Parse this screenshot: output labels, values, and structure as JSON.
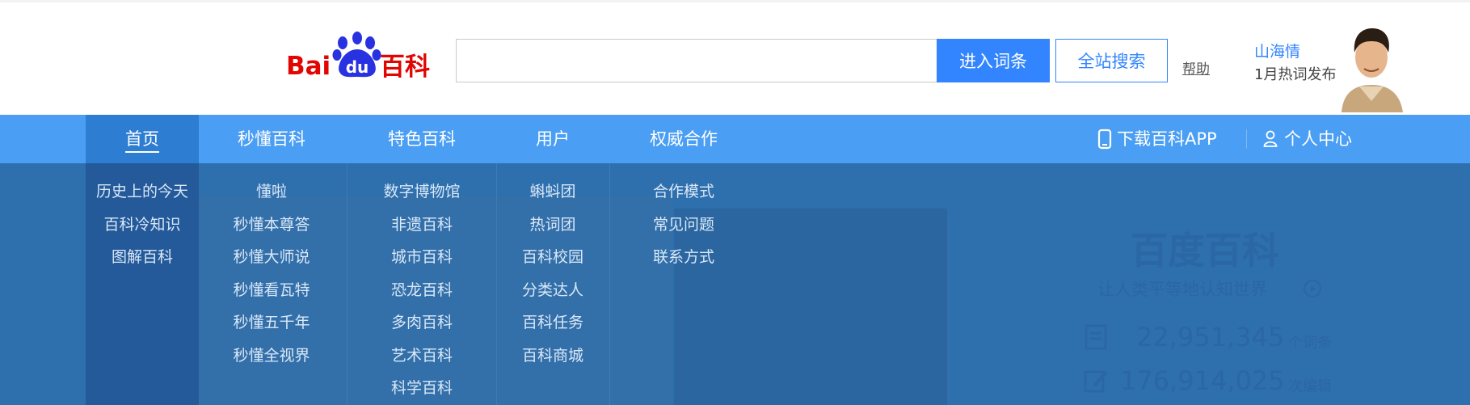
{
  "logo": {
    "alt": "Baidu百科"
  },
  "search": {
    "value": "",
    "placeholder": ""
  },
  "buttons": {
    "enter": "进入词条",
    "site_search": "全站搜索"
  },
  "help": "帮助",
  "promo": {
    "name": "山海情",
    "subtitle": "1月热词发布"
  },
  "nav": {
    "items": [
      {
        "label": "首页",
        "active": true
      },
      {
        "label": "秒懂百科"
      },
      {
        "label": "特色百科"
      },
      {
        "label": "用户"
      },
      {
        "label": "权威合作"
      }
    ],
    "app_label": "下载百科APP",
    "user_center": "个人中心"
  },
  "dropdown": [
    [
      "历史上的今天",
      "百科冷知识",
      "图解百科"
    ],
    [
      "懂啦",
      "秒懂本尊答",
      "秒懂大师说",
      "秒懂看瓦特",
      "秒懂五千年",
      "秒懂全视界"
    ],
    [
      "数字博物馆",
      "非遗百科",
      "城市百科",
      "恐龙百科",
      "多肉百科",
      "艺术百科",
      "科学百科"
    ],
    [
      "蝌蚪团",
      "热词团",
      "百科校园",
      "分类达人",
      "百科任务",
      "百科商城"
    ],
    [
      "合作模式",
      "常见问题",
      "联系方式"
    ]
  ],
  "background": {
    "brand": "百度百科",
    "slogan": "让人类平等地认知世界",
    "entries_count": "22,951,345",
    "entries_unit": "个词条",
    "editors_count": "176,914,025",
    "editors_unit": "次编辑"
  },
  "colors": {
    "primary": "#3385ff",
    "nav_bg": "#4a9ef3",
    "nav_active": "#2d7dd2",
    "dropdown_bg": "#2e6fad",
    "logo_red": "#e10602",
    "logo_blue": "#2932e1"
  }
}
